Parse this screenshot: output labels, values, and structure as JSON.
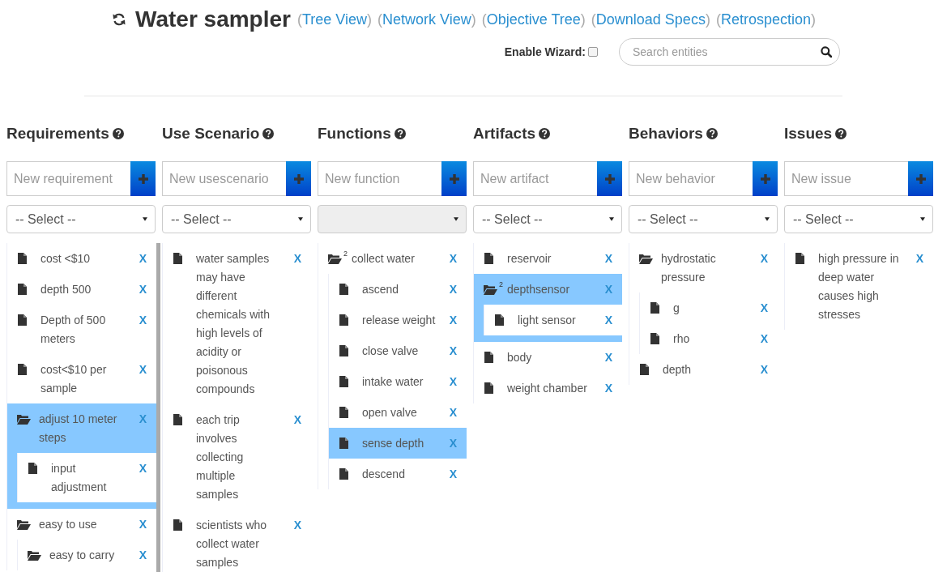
{
  "header": {
    "title": "Water sampler",
    "links": [
      "(Tree View)",
      "(Network View)",
      "(Objective Tree)",
      "(Download Specs)",
      "(Retrospection)"
    ]
  },
  "wizard": {
    "label": "Enable Wizard:",
    "checked": false
  },
  "search": {
    "placeholder": "Search entities"
  },
  "columns": [
    {
      "title": "Requirements",
      "add_placeholder": "New requirement",
      "select": {
        "value": "-- Select --",
        "disabled": false
      },
      "scrollbar": true,
      "items": [
        {
          "kind": "file",
          "label": "cost <$10",
          "remove": "X",
          "selected": false
        },
        {
          "kind": "file",
          "label": "depth 500",
          "remove": "X",
          "selected": false
        },
        {
          "kind": "file",
          "label": "Depth of 500 meters",
          "remove": "X",
          "selected": false
        },
        {
          "kind": "file",
          "label": "cost<$10 per sample",
          "remove": "X",
          "selected": false
        },
        {
          "kind": "folder",
          "label": "adjust 10 meter steps",
          "remove": "X",
          "selected": true,
          "children": [
            {
              "kind": "file",
              "label": "input adjustment",
              "remove": "X",
              "selected": false
            }
          ]
        },
        {
          "kind": "folder",
          "label": "easy to use",
          "remove": "X",
          "selected": false,
          "children": [
            {
              "kind": "folder",
              "label": "easy to carry",
              "remove": "X",
              "selected": false
            }
          ]
        }
      ]
    },
    {
      "title": "Use Scenario",
      "add_placeholder": "New usescenario",
      "select": {
        "value": "-- Select --",
        "disabled": false
      },
      "scrollbar": false,
      "items": [
        {
          "kind": "file",
          "label": "water samples may have different chemicals with high levels of acidity or poisonous compounds",
          "remove": "X",
          "selected": false
        },
        {
          "kind": "file",
          "label": "each trip involves collecting multiple samples",
          "remove": "X",
          "selected": false
        },
        {
          "kind": "file",
          "label": "scientists who collect water samples",
          "remove": "X",
          "selected": false
        }
      ]
    },
    {
      "title": "Functions",
      "add_placeholder": "New function",
      "select": {
        "disabled": true
      },
      "scrollbar": false,
      "items": [
        {
          "kind": "folder",
          "count": "2",
          "label": "collect water",
          "remove": "X",
          "selected": false,
          "children": [
            {
              "kind": "file",
              "label": "ascend",
              "remove": "X",
              "selected": false
            },
            {
              "kind": "file",
              "label": "release weight",
              "remove": "X",
              "selected": false
            },
            {
              "kind": "file",
              "label": "close valve",
              "remove": "X",
              "selected": false
            },
            {
              "kind": "file",
              "label": "intake water",
              "remove": "X",
              "selected": false
            },
            {
              "kind": "file",
              "label": "open valve",
              "remove": "X",
              "selected": false
            },
            {
              "kind": "file",
              "label": "sense depth",
              "remove": "X",
              "selected": true
            },
            {
              "kind": "file",
              "label": "descend",
              "remove": "X",
              "selected": false
            }
          ]
        }
      ]
    },
    {
      "title": "Artifacts",
      "add_placeholder": "New artifact",
      "select": {
        "value": "-- Select --",
        "disabled": false
      },
      "scrollbar": false,
      "items": [
        {
          "kind": "file",
          "label": "reservoir",
          "remove": "X",
          "selected": false
        },
        {
          "kind": "folder",
          "count": "2",
          "label": "depthsensor",
          "remove": "X",
          "selected": true,
          "children": [
            {
              "kind": "file",
              "label": "light sensor",
              "remove": "X",
              "selected": false
            }
          ]
        },
        {
          "kind": "file",
          "label": "body",
          "remove": "X",
          "selected": false
        },
        {
          "kind": "file",
          "label": "weight chamber",
          "remove": "X",
          "selected": false
        }
      ]
    },
    {
      "title": "Behaviors",
      "add_placeholder": "New behavior",
      "select": {
        "value": "-- Select --",
        "disabled": false
      },
      "scrollbar": false,
      "items": [
        {
          "kind": "folder",
          "label": "hydrostatic pressure",
          "remove": "X",
          "selected": false,
          "children": [
            {
              "kind": "file",
              "label": "g",
              "remove": "X",
              "selected": false
            },
            {
              "kind": "file",
              "label": "rho",
              "remove": "X",
              "selected": false
            }
          ]
        },
        {
          "kind": "file",
          "label": "depth",
          "remove": "X",
          "selected": false
        }
      ]
    },
    {
      "title": "Issues",
      "add_placeholder": "New issue",
      "select": {
        "value": "-- Select --",
        "disabled": false
      },
      "scrollbar": false,
      "items": [
        {
          "kind": "file",
          "label": "high pressure in deep water causes high stresses",
          "remove": "X",
          "selected": false
        }
      ]
    }
  ]
}
